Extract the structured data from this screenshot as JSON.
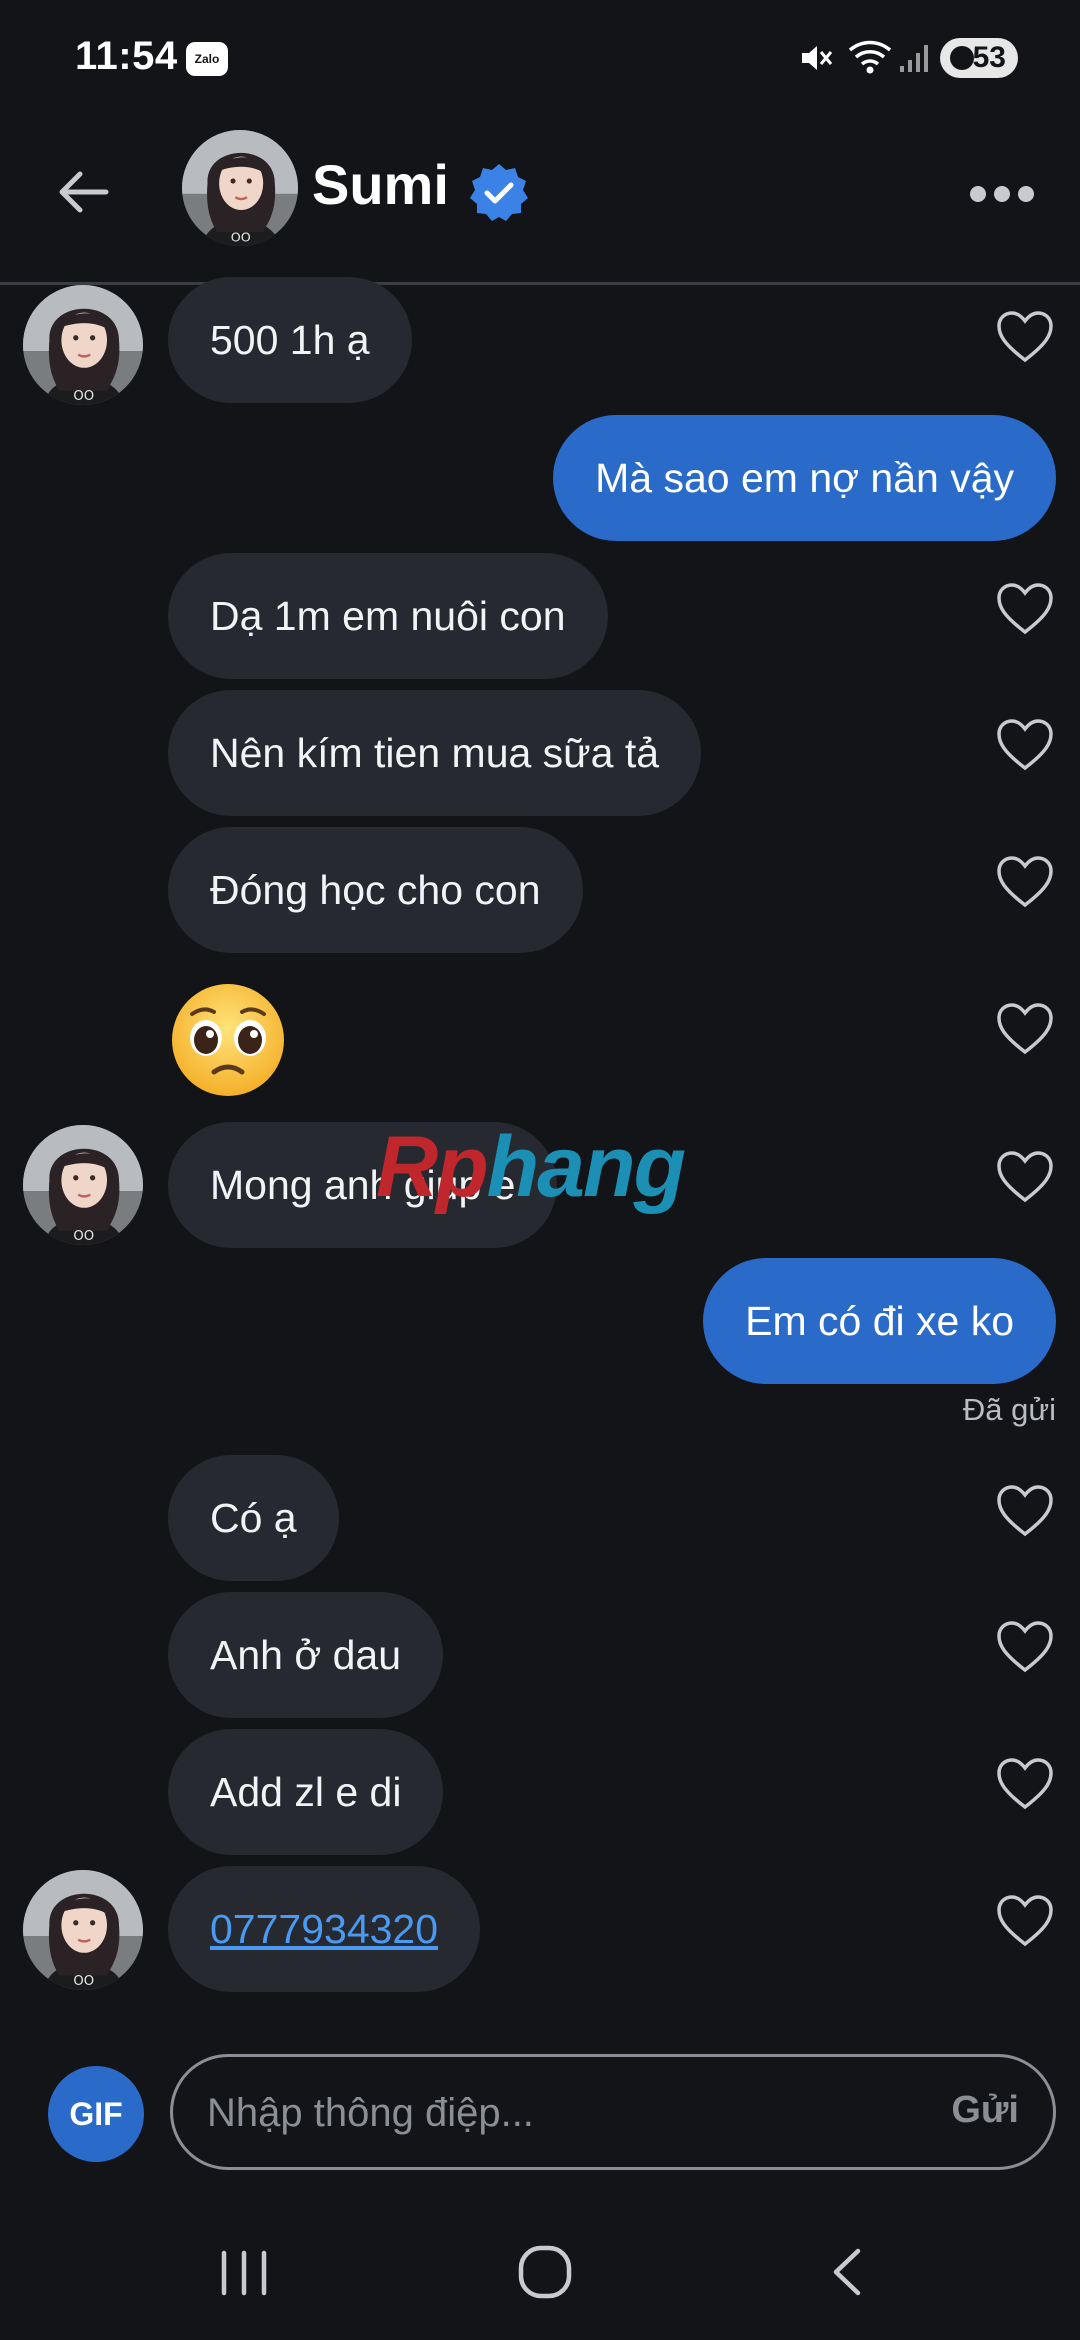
{
  "status_bar": {
    "time": "11:54",
    "app_badge": "Zalo",
    "battery": "53"
  },
  "header": {
    "name": "Sumi",
    "verified": true,
    "accent_color": "#2a6ac8"
  },
  "messages": [
    {
      "from": "them",
      "text": "500 1h ạ",
      "with_avatar": true
    },
    {
      "from": "me",
      "text": "Mà sao em nợ nần vậy"
    },
    {
      "from": "them",
      "text": "Dạ 1m em nuôi con"
    },
    {
      "from": "them",
      "text": "Nên kím tien mua sữa tả"
    },
    {
      "from": "them",
      "text": "Đóng học cho con"
    },
    {
      "from": "them",
      "emoji": "pleading-face"
    },
    {
      "from": "them",
      "text": "Mong anh giup e",
      "with_avatar": true
    },
    {
      "from": "me",
      "text": "Em có đi xe ko",
      "status": "Đã gửi"
    },
    {
      "from": "them",
      "text": "Có ạ"
    },
    {
      "from": "them",
      "text": "Anh ở dau"
    },
    {
      "from": "them",
      "text": "Add zl e di"
    },
    {
      "from": "them",
      "text": "0777934320",
      "is_link": true,
      "with_avatar": true
    }
  ],
  "watermark": {
    "part1": "Rp",
    "part2": "hang"
  },
  "composer": {
    "gif_label": "GIF",
    "placeholder": "Nhập thông điệp...",
    "send_label": "Gửi"
  },
  "colors": {
    "background": "#121418",
    "incoming_bubble": "#262930",
    "outgoing_bubble": "#2a6ac8",
    "link": "#4b9af2"
  }
}
